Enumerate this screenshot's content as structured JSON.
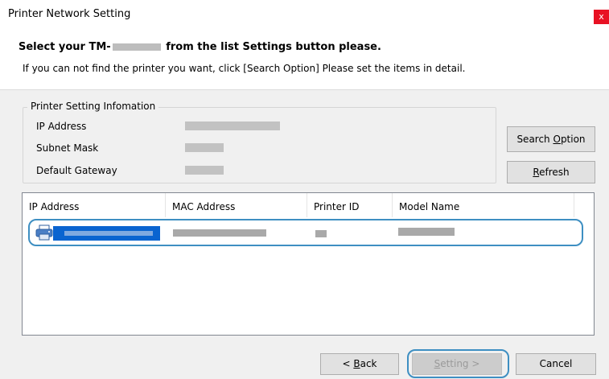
{
  "window": {
    "title": "Printer Network Setting",
    "close_glyph": "x"
  },
  "header": {
    "heading_prefix": "Select your TM-",
    "heading_suffix": "from the list Settings button please.",
    "instruction": "If you can not find the printer you want, click [Search Option] Please set the items in detail."
  },
  "settings_group": {
    "legend": "Printer Setting Infomation",
    "fields": [
      {
        "label": "IP Address"
      },
      {
        "label": "Subnet Mask"
      },
      {
        "label": "Default Gateway"
      }
    ]
  },
  "side_buttons": {
    "search_option": {
      "pre": "Search ",
      "accel": "O",
      "post": "ption"
    },
    "refresh": {
      "pre": "",
      "accel": "R",
      "post": "efresh"
    }
  },
  "list": {
    "columns": [
      "IP Address",
      "MAC Address",
      "Printer ID",
      "Model Name"
    ]
  },
  "footer": {
    "back": {
      "pre": "< ",
      "accel": "B",
      "post": "ack"
    },
    "setting": {
      "pre": "",
      "accel": "S",
      "post": "etting >"
    },
    "cancel": "Cancel"
  },
  "icons": {
    "close": "close-icon",
    "printer": "printer-icon"
  },
  "colors": {
    "accent": "#3e8fc2",
    "selection": "#0a64d0",
    "close": "#e81123"
  }
}
